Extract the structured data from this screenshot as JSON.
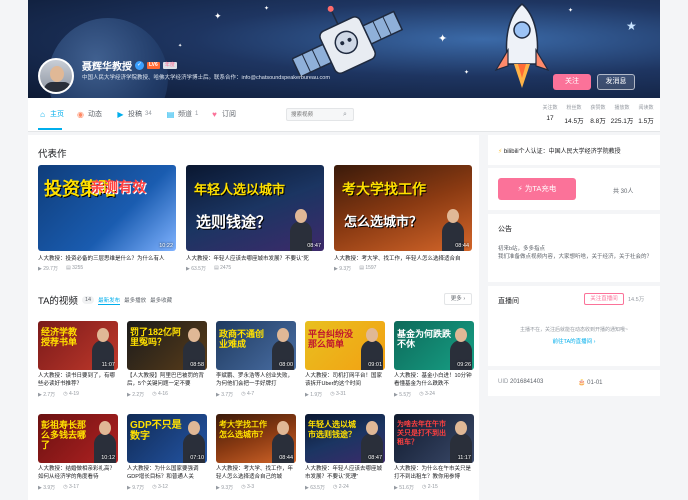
{
  "profile": {
    "name": "聂辉华教授",
    "level": "LV6",
    "tag": "年度",
    "bio": "中国人民大学经济学院教授、哈佛大学经济学博士后。联系合作：info@chatsoundspeakerbureau.com",
    "follow_label": "关注",
    "message_label": "发消息"
  },
  "nav": {
    "tabs": [
      {
        "label": "主页",
        "icon": "home-icon",
        "count": ""
      },
      {
        "label": "动态",
        "icon": "dynamic-icon",
        "count": ""
      },
      {
        "label": "投稿",
        "icon": "upload-icon",
        "count": "34"
      },
      {
        "label": "频道",
        "icon": "channel-icon",
        "count": "1"
      },
      {
        "label": "订阅",
        "icon": "subscribe-icon",
        "count": ""
      }
    ],
    "search_placeholder": "搜索视频",
    "stats": [
      {
        "label": "关注数",
        "value": "17"
      },
      {
        "label": "粉丝数",
        "value": "14.5万"
      },
      {
        "label": "获赞数",
        "value": "8.8万"
      },
      {
        "label": "播放数",
        "value": "225.1万"
      },
      {
        "label": "阅读数",
        "value": "1.5万"
      }
    ]
  },
  "representative": {
    "title": "代表作",
    "items": [
      {
        "thumb_text": "投资策略",
        "thumb_text2": "亲测有效",
        "duration": "10:22",
        "title": "人大教授：投资必备的三层思维是什么？为什么有人",
        "plays": "29.7万",
        "danmaku": "3255"
      },
      {
        "thumb_text": "年轻人选以城市",
        "thumb_text2": "选则钱途？",
        "duration": "08:47",
        "title": "人大教授：年轻人应该去哪座城市发展？不要认“死",
        "plays": "63.5万",
        "danmaku": "2475"
      },
      {
        "thumb_text": "考大学找工作",
        "thumb_text2": "怎么选城市？",
        "duration": "08:44",
        "title": "人大教授：考大学、找工作，年轻人怎么选择适合自",
        "plays": "9.3万",
        "danmaku": "1597"
      }
    ]
  },
  "videos": {
    "title": "TA的视频",
    "count": "14",
    "sort_options": [
      "最新发布",
      "最多播放",
      "最多收藏"
    ],
    "more_label": "更多",
    "items": [
      {
        "thumb_text": "经济学教授荐书单",
        "duration": "11:07",
        "title": "人大教授：读书日要到了，有哪些必读好书推荐？",
        "plays": "2.7万",
        "date": "4-19"
      },
      {
        "thumb_text": "罚了182亿阿里冤吗？",
        "duration": "08:58",
        "title": "【人大教授】阿里巴巴被罚的背后，5个关键问题一定不要",
        "plays": "2.2万",
        "date": "4-16"
      },
      {
        "thumb_text": "政商不通创业难成",
        "duration": "08:00",
        "title": "李斌鹏、罗永浩等人创业失败，为何他们会把一手好牌打",
        "plays": "3.7万",
        "date": "4-7"
      },
      {
        "thumb_text": "平台纠纷没那么简单",
        "duration": "09:01",
        "title": "人大教授：司机打网平台！国家该拆开Uber的这个时间",
        "plays": "1.9万",
        "date": "3-31"
      },
      {
        "thumb_text": "基金为何跌跌不休",
        "duration": "09:26",
        "title": "人大教授：基金小白进！10分钟看懂基金为什么跌跌不",
        "plays": "5.5万",
        "date": "3-24"
      },
      {
        "thumb_text": "彭祖寿长那么多钱去哪了",
        "duration": "10:12",
        "title": "人大教授：结婚做相亲彩礼高？如何从经济学的角度看待",
        "plays": "3.9万",
        "date": "3-17"
      },
      {
        "thumb_text": "GDP不只是数字",
        "duration": "07:10",
        "title": "人大教授：为什么国家要强调GDP增长目标？和普通人关",
        "plays": "9.7万",
        "date": "3-12"
      },
      {
        "thumb_text": "考大学找工作怎么选城市？",
        "duration": "08:44",
        "title": "人大教授：考大学、找工作，年轻人怎么选择适合自己的城",
        "plays": "9.3万",
        "date": "3-3"
      },
      {
        "thumb_text": "年轻人选以城市选则钱途？",
        "duration": "08:47",
        "title": "人大教授：年轻人应该去哪座城市发展？不要认“死理”",
        "plays": "63.5万",
        "date": "2-24"
      },
      {
        "thumb_text": "为啥去年在午市关只是打不到出租车？",
        "duration": "11:17",
        "title": "人大教授：为什么在午市关只是打不到出租车？教你用参博",
        "plays": "51.6万",
        "date": "2-15"
      }
    ]
  },
  "side": {
    "certification": "bilibili个人认证：中国人民大学经济学院教授",
    "charge_label": "为TA充电",
    "charge_count": "共 30人",
    "notice_title": "公告",
    "notice_text": "初来b站，多多指点\n我们准备做点视频内容，大家想听啥，关于经济，关于社会的？",
    "live_title": "直播间",
    "live_follow_label": "关注直播间",
    "live_follow_count": "14.5万",
    "live_status": "主播不在，关注后就能在动态收到开播的通知哦~",
    "live_link": "前往TA的直播间",
    "uid": "2016841403",
    "birthday": "01-01"
  },
  "colors": {
    "accent": "#00aeec",
    "pink": "#fb7299",
    "bg": "#f4f5f7"
  }
}
